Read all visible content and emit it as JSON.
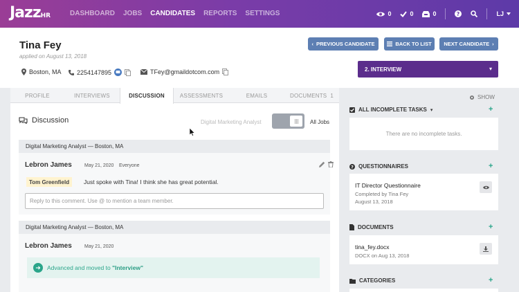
{
  "nav": {
    "logo": "Jazz",
    "logo_suffix": "HR",
    "links": [
      "DASHBOARD",
      "JOBS",
      "CANDIDATES",
      "REPORTS",
      "SETTINGS"
    ],
    "active_link": "CANDIDATES",
    "views_count": "0",
    "checks_count": "0",
    "inbox_count": "0",
    "user_initials": "LJ"
  },
  "candidate": {
    "name": "Tina Fey",
    "applied": "applied on August 13, 2018",
    "location": "Boston, MA",
    "phone": "2254147895",
    "email": "TFey@gmaildotcom.com"
  },
  "buttons": {
    "previous": "PREVIOUS CANDIDATE",
    "back": "BACK TO LIST",
    "next": "NEXT CANDIDATE"
  },
  "stage": "2. INTERVIEW",
  "tabs": [
    "PROFILE",
    "INTERVIEWS",
    "DISCUSSION",
    "ASSESSMENTS",
    "EMAILS",
    "DOCUMENTS"
  ],
  "documents_count": "1",
  "discussion": {
    "title": "Discussion",
    "filter_label": "Digital Marketing Analyst",
    "all_jobs": "All Jobs",
    "threads": [
      {
        "job": "Digital Marketing Analyst — Boston, MA",
        "author": "Lebron James",
        "date": "May 21, 2020",
        "visibility": "Everyone",
        "mention": "Tom Greenfield",
        "text": "Just spoke with Tina! I think she has great potential.",
        "reply_placeholder": "Reply to this comment. Use @ to mention a team member."
      },
      {
        "job": "Digital Marketing Analyst — Boston, MA",
        "author": "Lebron James",
        "date": "May 21, 2020",
        "moved_prefix": "Advanced and moved to",
        "moved_stage": "\"Interview\""
      }
    ]
  },
  "sidebar": {
    "show": "SHOW",
    "tasks_title": "ALL INCOMPLETE TASKS",
    "tasks_empty": "There are no incomplete tasks.",
    "questionnaires_title": "QUESTIONNAIRES",
    "questionnaire": {
      "name": "IT Director Questionnaire",
      "by": "Completed by Tina Fey",
      "date": "August 13, 2018"
    },
    "documents_title": "DOCUMENTS",
    "document": {
      "name": "tina_fey.docx",
      "info": "DOCX on Aug 13, 2018"
    },
    "categories_title": "CATEGORIES"
  },
  "colors": {
    "nav_start": "#9a3d96",
    "nav_end": "#5d3aa8",
    "button": "#5d7fb3",
    "stage": "#5b2d8c",
    "accent_green": "#2aa58a"
  }
}
